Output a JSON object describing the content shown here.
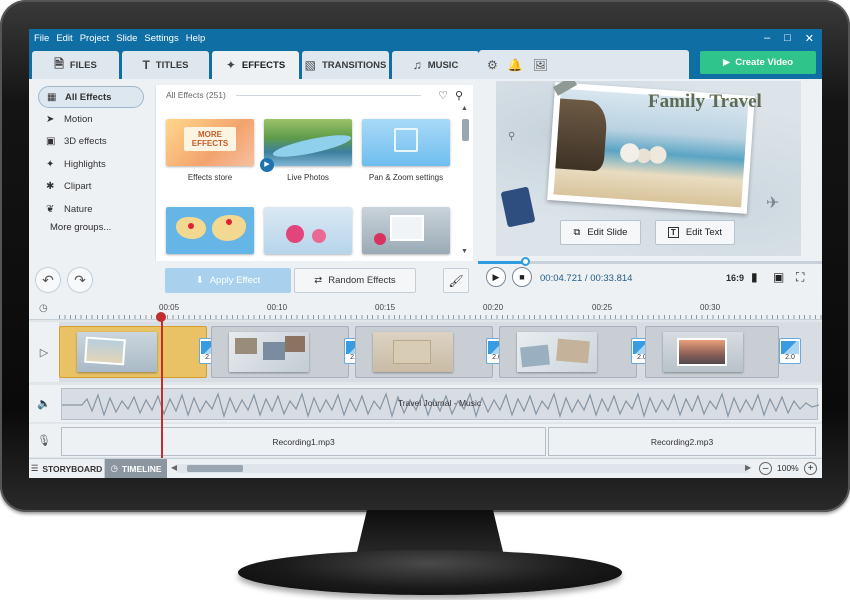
{
  "menu": [
    "File",
    "Edit",
    "Project",
    "Slide",
    "Settings",
    "Help"
  ],
  "tabs": [
    {
      "label": "FILES",
      "icon": "files-icon"
    },
    {
      "label": "TITLES",
      "icon": "titles-icon"
    },
    {
      "label": "EFFECTS",
      "icon": "effects-icon",
      "active": true
    },
    {
      "label": "TRANSITIONS",
      "icon": "transitions-icon"
    },
    {
      "label": "MUSIC",
      "icon": "music-icon"
    }
  ],
  "create_video_label": "Create Video",
  "effect_groups": [
    {
      "label": "All Effects",
      "icon": "grid-icon",
      "active": true
    },
    {
      "label": "Motion",
      "icon": "motion-icon"
    },
    {
      "label": "3D effects",
      "icon": "cube-icon"
    },
    {
      "label": "Highlights",
      "icon": "sparkle-icon"
    },
    {
      "label": "Clipart",
      "icon": "puzzle-icon"
    },
    {
      "label": "Nature",
      "icon": "leaf-icon"
    }
  ],
  "more_groups_label": "More groups...",
  "gallery": {
    "header": "All Effects (251)",
    "items": [
      {
        "label": "Effects store",
        "thumb_text": "MORE EFFECTS"
      },
      {
        "label": "Live Photos"
      },
      {
        "label": "Pan & Zoom settings"
      },
      {
        "label": ""
      },
      {
        "label": ""
      },
      {
        "label": ""
      }
    ]
  },
  "buttons": {
    "apply_effect": "Apply Effect",
    "random_effects": "Random Effects",
    "edit_slide": "Edit Slide",
    "edit_text": "Edit Text"
  },
  "preview": {
    "title_text": "Family Travel",
    "time_current": "00:04.721",
    "time_total": "00:33.814",
    "time_separator": "/",
    "aspect": "16:9",
    "progress": 0.14
  },
  "timeline": {
    "ruler_labels": [
      "00:05",
      "00:10",
      "00:15",
      "00:20",
      "00:25",
      "00:30"
    ],
    "transition_duration": "2.0",
    "slide_count": 5,
    "music_label": "Travel Journal - Music",
    "recordings": [
      "Recording1.mp3",
      "Recording2.mp3"
    ],
    "tab_storyboard": "STORYBOARD",
    "tab_timeline": "TIMELINE",
    "zoom": "100%"
  },
  "colors": {
    "menubar": "#0f6fa5",
    "create_video": "#2fc489",
    "playhead": "#c22d2d",
    "selected_slide": "#e9c266"
  }
}
